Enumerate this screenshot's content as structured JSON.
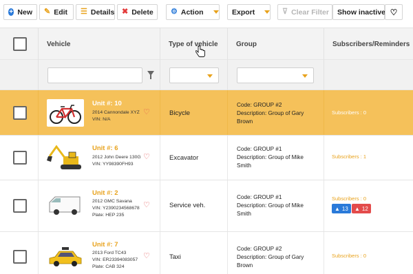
{
  "toolbar": {
    "new": "New",
    "edit": "Edit",
    "details": "Details",
    "delete": "Delete",
    "action": "Action",
    "export": "Export",
    "clear_filter": "Clear Filter",
    "show_inactive": "Show inactive"
  },
  "columns": {
    "vehicle": "Vehicle",
    "type": "Type of vehicle",
    "group": "Group",
    "subscribers": "Subscribers/Reminders"
  },
  "rows": [
    {
      "unit": "Unit #: 10",
      "line1": "2014 Cannondale XYZ",
      "line2": "VIN: N/A",
      "line3": "",
      "type": "Bicycle",
      "group_code": "Code: GROUP #2",
      "group_desc": "Description: Group of Gary Brown",
      "subscribers": "Subscribers : 0",
      "icon": "bicycle-icon"
    },
    {
      "unit": "Unit #: 6",
      "line1": "2012 John Deere 130G",
      "line2": "VIN: YY98390FH93",
      "line3": "",
      "type": "Excavator",
      "group_code": "Code: GROUP #1",
      "group_desc": "Description: Group of Mike Smith",
      "subscribers": "Subscribers : 1",
      "icon": "excavator-icon"
    },
    {
      "unit": "Unit #: 2",
      "line1": "2012 GMC Savana",
      "line2": "VIN: Y2390234568678",
      "line3": "Plate: HEP 235",
      "type": "Service veh.",
      "group_code": "Code: GROUP #1",
      "group_desc": "Description: Group of Mike Smith",
      "subscribers": "Subscribers : 0",
      "badge_warn_blue": "13",
      "badge_warn_red": "12",
      "icon": "van-icon"
    },
    {
      "unit": "Unit #: 7",
      "line1": "2013 Ford TC43",
      "line2": "VIN: ER23394083057",
      "line3": "Plate: CAB 324",
      "type": "Taxi",
      "group_code": "Code: GROUP #2",
      "group_desc": "Description: Group of Gary Brown",
      "subscribers": "Subscribers : 0",
      "icon": "taxi-icon"
    }
  ],
  "colors": {
    "accent": "#e8a21c",
    "selected_row": "#f5c15a",
    "info": "#2a7ad9",
    "danger": "#e34b4b"
  }
}
